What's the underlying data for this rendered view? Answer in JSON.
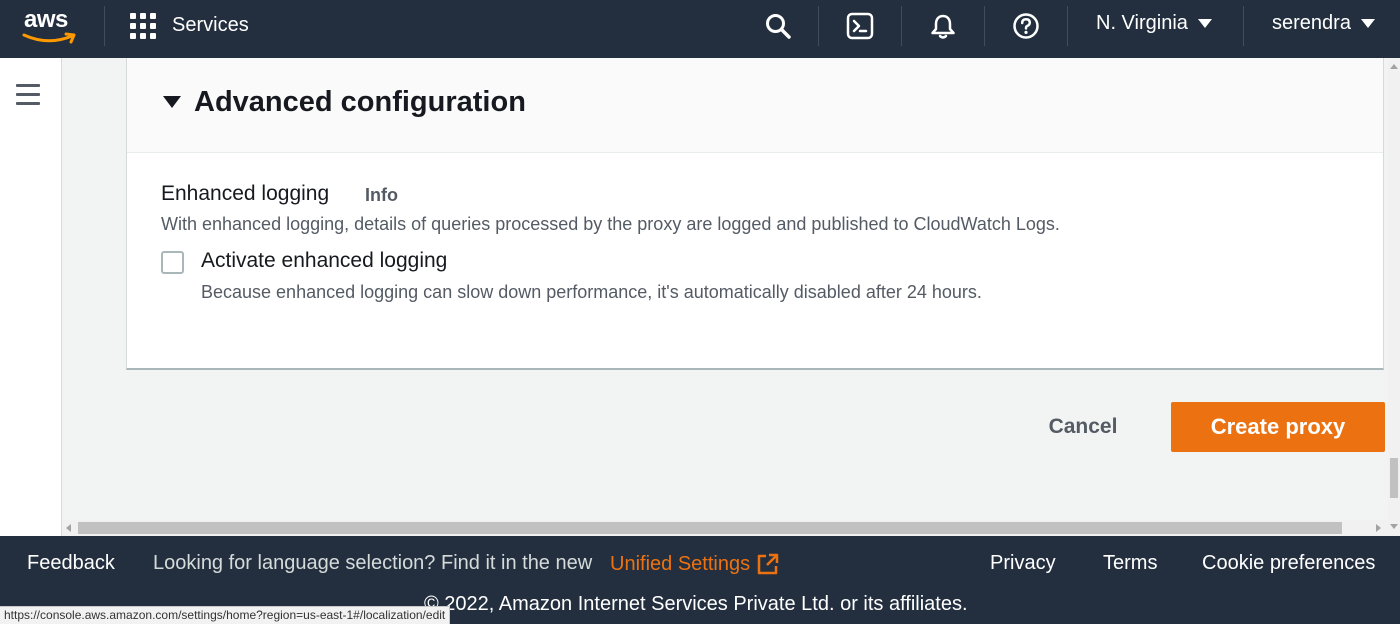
{
  "nav": {
    "logo_text": "aws",
    "services_label": "Services",
    "region_label": "N. Virginia",
    "user_label": "serendra",
    "icons": [
      "search-icon",
      "cloudshell-icon",
      "notifications-icon",
      "help-icon"
    ]
  },
  "panel": {
    "title": "Advanced configuration",
    "field_label": "Enhanced logging",
    "info_link": "Info",
    "field_description": "With enhanced logging, details of queries processed by the proxy are logged and published to CloudWatch Logs.",
    "checkbox_label": "Activate enhanced logging",
    "checkbox_checked": false,
    "checkbox_description": "Because enhanced logging can slow down performance, it's automatically disabled after 24 hours."
  },
  "actions": {
    "cancel_label": "Cancel",
    "create_label": "Create proxy"
  },
  "footer": {
    "feedback": "Feedback",
    "language_text": "Looking for language selection? Find it in the new",
    "unified_settings": "Unified Settings",
    "privacy": "Privacy",
    "terms": "Terms",
    "cookies": "Cookie preferences",
    "copyright": "© 2022, Amazon Internet Services Private Ltd. or its affiliates."
  },
  "status_bar_url": "https://console.aws.amazon.com/settings/home?region=us-east-1#/localization/edit",
  "colors": {
    "nav_bg": "#232f3e",
    "accent": "#ec7211",
    "page_bg": "#f2f3f3"
  }
}
